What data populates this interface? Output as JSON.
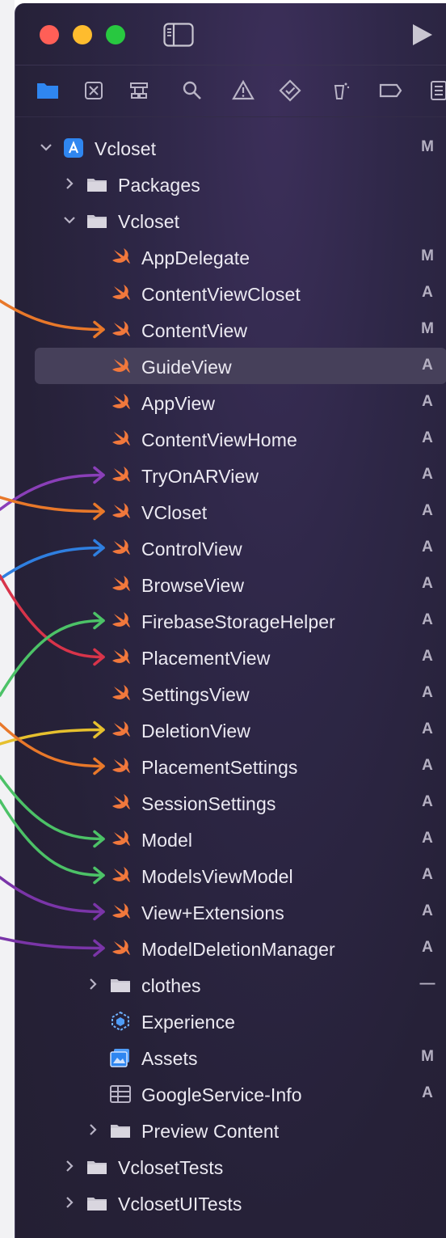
{
  "colors": {
    "panel_bg": "#262138",
    "swift_orange": "#f1783c",
    "folder_gray": "#c9c6d1",
    "selection": "#46405a",
    "status_text": "#b5b0c2"
  },
  "toolbar": {
    "icons": [
      "sidebar-toggle-icon",
      "run-icon"
    ]
  },
  "navigator_tabs": [
    {
      "name": "project-navigator-icon",
      "selected": true
    },
    {
      "name": "source-control-navigator-icon",
      "selected": false
    },
    {
      "name": "symbol-navigator-icon",
      "selected": false
    },
    {
      "name": "find-navigator-icon",
      "selected": false
    },
    {
      "name": "issue-navigator-icon",
      "selected": false
    },
    {
      "name": "test-navigator-icon",
      "selected": false
    },
    {
      "name": "debug-navigator-icon",
      "selected": false
    },
    {
      "name": "breakpoint-navigator-icon",
      "selected": false
    },
    {
      "name": "report-navigator-icon",
      "selected": false
    }
  ],
  "tree": {
    "rows": [
      {
        "label": "Vcloset",
        "status": "M",
        "icon": "project-icon",
        "disclosure": "open",
        "depth": 0
      },
      {
        "label": "Packages",
        "status": "",
        "icon": "folder-icon",
        "disclosure": "closed",
        "depth": 1
      },
      {
        "label": "Vcloset",
        "status": "",
        "icon": "folder-icon",
        "disclosure": "open",
        "depth": 1
      },
      {
        "label": "AppDelegate",
        "status": "M",
        "icon": "swift-icon",
        "disclosure": "none",
        "depth": 2
      },
      {
        "label": "ContentViewCloset",
        "status": "A",
        "icon": "swift-icon",
        "disclosure": "none",
        "depth": 2
      },
      {
        "label": "ContentView",
        "status": "M",
        "icon": "swift-icon",
        "disclosure": "none",
        "depth": 2
      },
      {
        "label": "GuideView",
        "status": "A",
        "icon": "swift-icon",
        "disclosure": "none",
        "depth": 2,
        "selected": true
      },
      {
        "label": "AppView",
        "status": "A",
        "icon": "swift-icon",
        "disclosure": "none",
        "depth": 2
      },
      {
        "label": "ContentViewHome",
        "status": "A",
        "icon": "swift-icon",
        "disclosure": "none",
        "depth": 2
      },
      {
        "label": "TryOnARView",
        "status": "A",
        "icon": "swift-icon",
        "disclosure": "none",
        "depth": 2
      },
      {
        "label": "VCloset",
        "status": "A",
        "icon": "swift-icon",
        "disclosure": "none",
        "depth": 2
      },
      {
        "label": "ControlView",
        "status": "A",
        "icon": "swift-icon",
        "disclosure": "none",
        "depth": 2
      },
      {
        "label": "BrowseView",
        "status": "A",
        "icon": "swift-icon",
        "disclosure": "none",
        "depth": 2
      },
      {
        "label": "FirebaseStorageHelper",
        "status": "A",
        "icon": "swift-icon",
        "disclosure": "none",
        "depth": 2
      },
      {
        "label": "PlacementView",
        "status": "A",
        "icon": "swift-icon",
        "disclosure": "none",
        "depth": 2
      },
      {
        "label": "SettingsView",
        "status": "A",
        "icon": "swift-icon",
        "disclosure": "none",
        "depth": 2
      },
      {
        "label": "DeletionView",
        "status": "A",
        "icon": "swift-icon",
        "disclosure": "none",
        "depth": 2
      },
      {
        "label": "PlacementSettings",
        "status": "A",
        "icon": "swift-icon",
        "disclosure": "none",
        "depth": 2
      },
      {
        "label": "SessionSettings",
        "status": "A",
        "icon": "swift-icon",
        "disclosure": "none",
        "depth": 2
      },
      {
        "label": "Model",
        "status": "A",
        "icon": "swift-icon",
        "disclosure": "none",
        "depth": 2
      },
      {
        "label": "ModelsViewModel",
        "status": "A",
        "icon": "swift-icon",
        "disclosure": "none",
        "depth": 2
      },
      {
        "label": "View+Extensions",
        "status": "A",
        "icon": "swift-icon",
        "disclosure": "none",
        "depth": 2
      },
      {
        "label": "ModelDeletionManager",
        "status": "A",
        "icon": "swift-icon",
        "disclosure": "none",
        "depth": 2
      },
      {
        "label": "clothes",
        "status": "—",
        "icon": "folder-icon",
        "disclosure": "closed",
        "depth": 2
      },
      {
        "label": "Experience",
        "status": "",
        "icon": "reality-composer-icon",
        "disclosure": "none",
        "depth": 2
      },
      {
        "label": "Assets",
        "status": "M",
        "icon": "asset-catalog-icon",
        "disclosure": "none",
        "depth": 2
      },
      {
        "label": "GoogleService-Info",
        "status": "A",
        "icon": "plist-icon",
        "disclosure": "none",
        "depth": 2
      },
      {
        "label": "Preview Content",
        "status": "",
        "icon": "folder-icon",
        "disclosure": "closed",
        "depth": 2
      },
      {
        "label": "VclosetTests",
        "status": "",
        "icon": "folder-icon",
        "disclosure": "closed",
        "depth": 1
      },
      {
        "label": "VclosetUITests",
        "status": "",
        "icon": "folder-icon",
        "disclosure": "closed",
        "depth": 1
      }
    ]
  },
  "arrows": [
    {
      "target": "ContentView",
      "color": "#e8782a"
    },
    {
      "target": "TryOnARView",
      "color": "#8a3fb8"
    },
    {
      "target": "VCloset",
      "color": "#e8782a"
    },
    {
      "target": "ControlView",
      "color": "#2f7fe0"
    },
    {
      "target": "PlacementView",
      "color": "#d8344a"
    },
    {
      "target": "FirebaseStorageHelper",
      "color": "#4cc267"
    },
    {
      "target": "DeletionView",
      "color": "#e6c02e"
    },
    {
      "target": "PlacementSettings",
      "color": "#e8782a"
    },
    {
      "target": "Model",
      "color": "#4cc267"
    },
    {
      "target": "ModelsViewModel",
      "color": "#4cc267"
    },
    {
      "target": "View+Extensions",
      "color": "#7a35a8"
    },
    {
      "target": "ModelDeletionManager",
      "color": "#7a35a8"
    }
  ]
}
